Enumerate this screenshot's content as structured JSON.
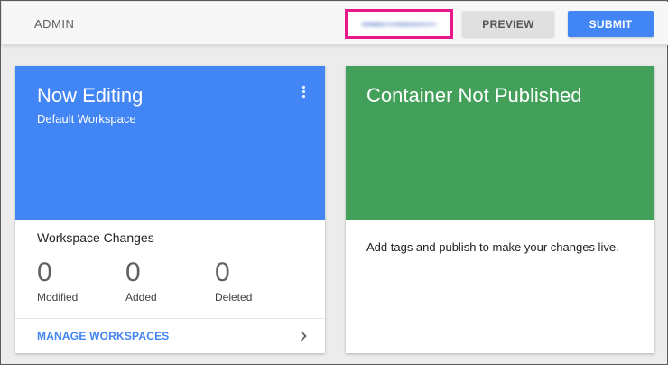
{
  "topbar": {
    "admin_label": "ADMIN",
    "preview_label": "PREVIEW",
    "submit_label": "SUBMIT",
    "accent_color": "#4285f4",
    "highlight_color": "#e8178a"
  },
  "workspace_card": {
    "title": "Now Editing",
    "subtitle": "Default Workspace",
    "changes_heading": "Workspace Changes",
    "stats": [
      {
        "value": "0",
        "label": "Modified"
      },
      {
        "value": "0",
        "label": "Added"
      },
      {
        "value": "0",
        "label": "Deleted"
      }
    ],
    "manage_label": "MANAGE WORKSPACES",
    "header_color": "#4285f4",
    "menu_icon": "more-vert-icon",
    "chevron_icon": "chevron-right-icon"
  },
  "container_card": {
    "title": "Container Not Published",
    "message": "Add tags and publish to make your changes live.",
    "header_color": "#43a05a"
  }
}
